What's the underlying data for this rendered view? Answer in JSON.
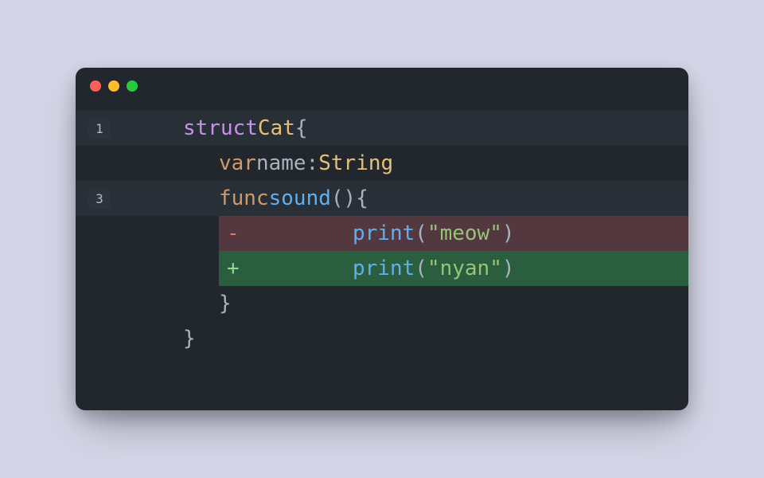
{
  "window": {
    "traffic_lights": [
      "close",
      "minimize",
      "zoom"
    ]
  },
  "editor": {
    "lines": [
      {
        "number": "1",
        "active": true,
        "tokens": {
          "kw": "struct",
          "type": "Cat",
          "brace": "{"
        }
      },
      {
        "tokens": {
          "kw": "var",
          "name": "name",
          "colon": ":",
          "type": "String"
        }
      },
      {
        "number": "3",
        "active": true,
        "tokens": {
          "kw": "func",
          "name": "sound",
          "parens": "()",
          "brace": "{"
        }
      },
      {
        "diff": "removed",
        "marker": "-",
        "tokens": {
          "func": "print",
          "open": "(",
          "string": "\"meow\"",
          "close": ")"
        }
      },
      {
        "diff": "added",
        "marker": "+",
        "tokens": {
          "func": "print",
          "open": "(",
          "string": "\"nyan\"",
          "close": ")"
        }
      },
      {
        "tokens": {
          "brace": "}"
        }
      },
      {
        "tokens": {
          "brace": "}"
        }
      }
    ]
  }
}
